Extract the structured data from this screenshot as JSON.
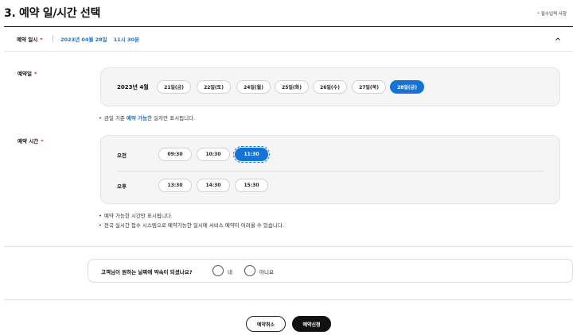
{
  "header": {
    "title": "3. 예약 일/시간 선택",
    "required_star": "*",
    "required_note": "필수입력 사항"
  },
  "summary": {
    "label": "예약 일시",
    "star": "*",
    "date": "2023년 04월 28일",
    "time": "11시 30분",
    "toggle_icon": "chevron-up-icon"
  },
  "date_section": {
    "label": "예약일",
    "star": "*",
    "month": "2023년 4월",
    "dates": [
      "21일(금)",
      "22일(토)",
      "24일(월)",
      "25일(화)",
      "26일(수)",
      "27일(목)",
      "28일(금)"
    ],
    "selected_index": 6,
    "note_bullet": "•",
    "note_prefix": "금일 기준 ",
    "note_highlight": "예약 가능",
    "note_suffix": "한 일자만 표시됩니다."
  },
  "time_section": {
    "label": "예약 시간",
    "star": "*",
    "am_label": "오전",
    "am_times": [
      "09:30",
      "10:30",
      "11:30"
    ],
    "pm_label": "오후",
    "pm_times": [
      "13:30",
      "14:30",
      "15:30"
    ],
    "selected": "11:30",
    "notes": [
      "예약 가능한 시간만 표시됩니다.",
      "전국 실시간 접수 시스템으로 예약가능한 일시에 서비스 예약이 어려울 수 있습니다."
    ],
    "note_bullet": "•"
  },
  "consent": {
    "question": "고객님이 원하는 날짜에 약속이 되셨나요?",
    "yes": "네",
    "no": "아니요"
  },
  "buttons": {
    "cancel": "예약취소",
    "submit": "예약신청"
  },
  "colors": {
    "accent": "#1673d6",
    "required": "#e02020",
    "panel_bg": "#f5f5f5"
  }
}
